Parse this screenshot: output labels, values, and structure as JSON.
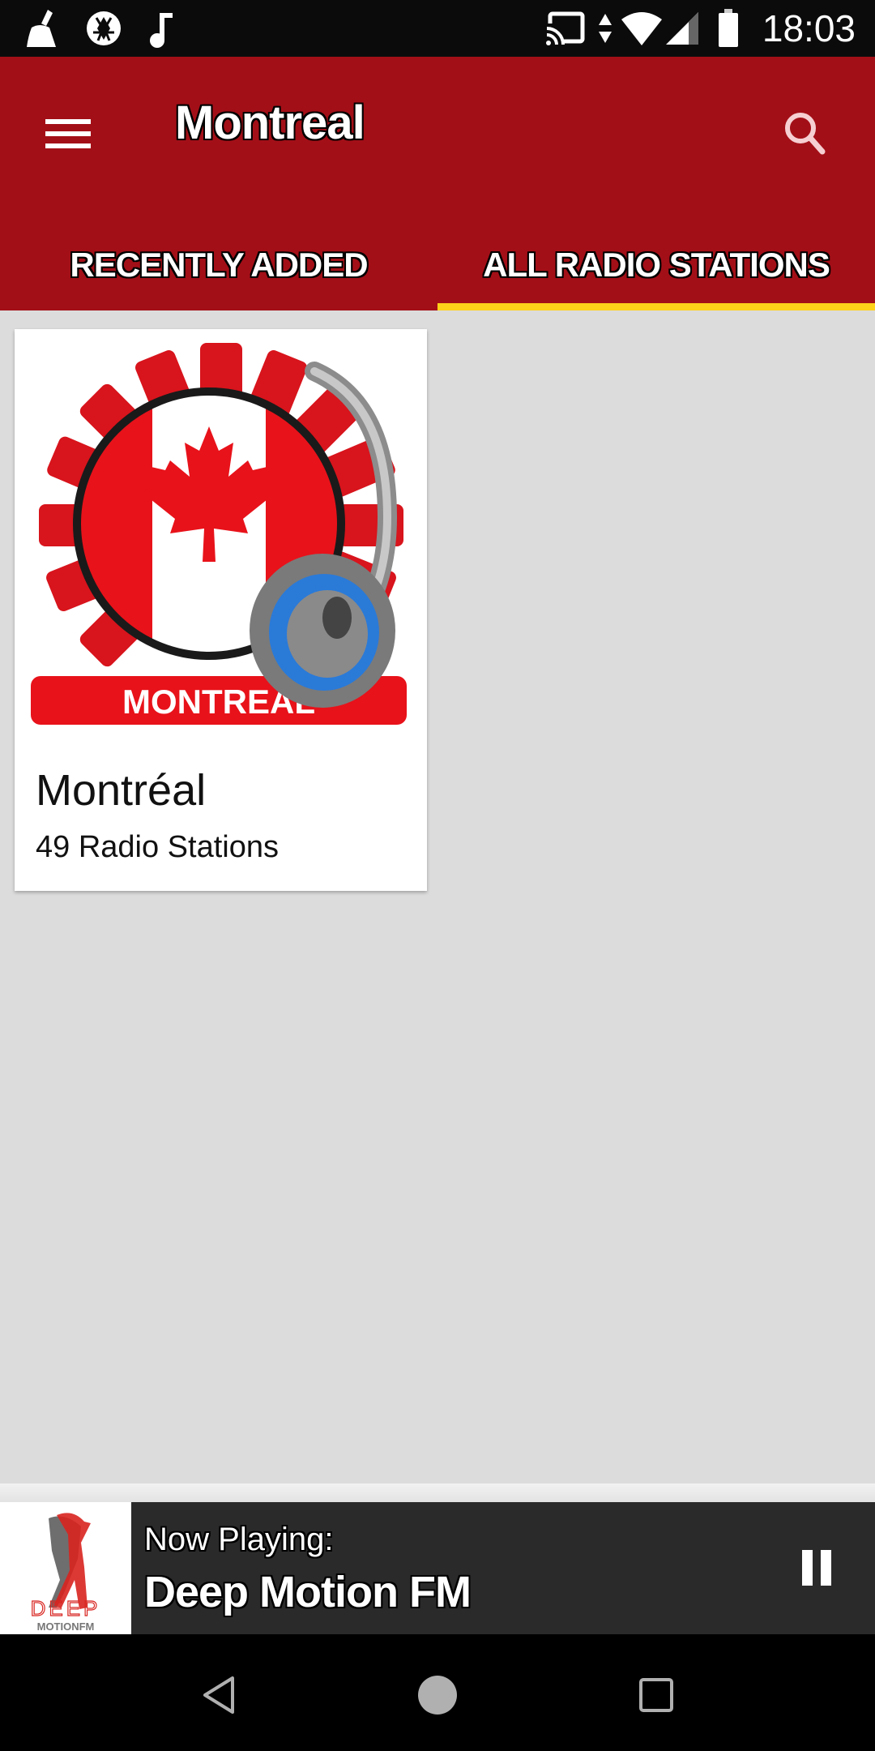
{
  "status_bar": {
    "left_icons": [
      "cleaner-broom-icon",
      "camera-aperture-icon",
      "music-note-icon"
    ],
    "right_icons": [
      "cast-icon",
      "data-arrows-icon",
      "wifi-icon",
      "cell-signal-icon",
      "battery-icon"
    ],
    "time": "18:03"
  },
  "app_bar": {
    "menu_icon": "hamburger-menu-icon",
    "title": "Montreal",
    "search_icon": "search-icon",
    "color": "#a30f17"
  },
  "tabs": [
    {
      "label": "RECENTLY ADDED",
      "selected": false
    },
    {
      "label": "ALL RADIO STATIONS",
      "selected": true
    }
  ],
  "tab_indicator_color": "#ffd21a",
  "cards": [
    {
      "image_alt": "Montreal radio logo with Canadian flag and headphones",
      "image_banner_text": "MONTREAL",
      "title": "Montréal",
      "subtitle": "49 Radio Stations"
    }
  ],
  "player": {
    "logo_text_top": "DEEP",
    "logo_text_bottom": "MOTIONFM",
    "label": "Now Playing:",
    "station": "Deep Motion FM",
    "state": "playing",
    "control_icon": "pause-icon"
  },
  "nav_bar": {
    "buttons": [
      "back-icon",
      "home-icon",
      "recents-icon"
    ]
  }
}
